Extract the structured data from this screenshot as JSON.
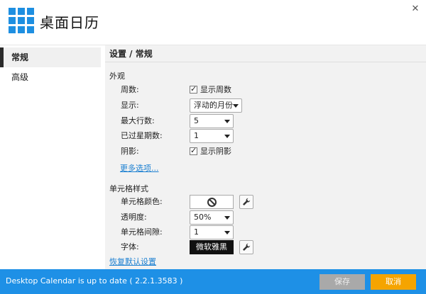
{
  "app": {
    "title": "桌面日历",
    "close_glyph": "✕"
  },
  "sidebar": {
    "items": [
      {
        "label": "常规",
        "active": true
      },
      {
        "label": "高级",
        "active": false
      }
    ]
  },
  "content": {
    "title": "设置 / 常规",
    "appearance": {
      "heading": "外观",
      "week_number": {
        "label": "周数:",
        "checkbox_label": "显示周数",
        "checked": true
      },
      "display": {
        "label": "显示:",
        "value": "浮动的月份"
      },
      "max_rows": {
        "label": "最大行数:",
        "value": "5"
      },
      "past_weeks": {
        "label": "已过星期数:",
        "value": "1"
      },
      "shadow": {
        "label": "阴影:",
        "checkbox_label": "显示阴影",
        "checked": true
      },
      "more_link": "更多选项..."
    },
    "cell_style": {
      "heading": "单元格样式",
      "cell_color": {
        "label": "单元格颜色:",
        "value_icon": "no-color-icon"
      },
      "opacity": {
        "label": "透明度:",
        "value": "50%"
      },
      "cell_spacing": {
        "label": "单元格间隙:",
        "value": "1"
      },
      "font": {
        "label": "字体:",
        "value": "微软雅黑"
      },
      "restore_link": "恢复默认设置"
    }
  },
  "status": {
    "text": "Desktop Calendar is up to date ( 2.2.1.3583 )"
  },
  "buttons": {
    "save": "保存",
    "cancel": "取消"
  },
  "colors": {
    "accent": "#1e90e6",
    "cancel": "#f5a400",
    "save_disabled": "#a9a9a9",
    "link": "#1a7fd1",
    "logo": "#1e8fe1"
  }
}
